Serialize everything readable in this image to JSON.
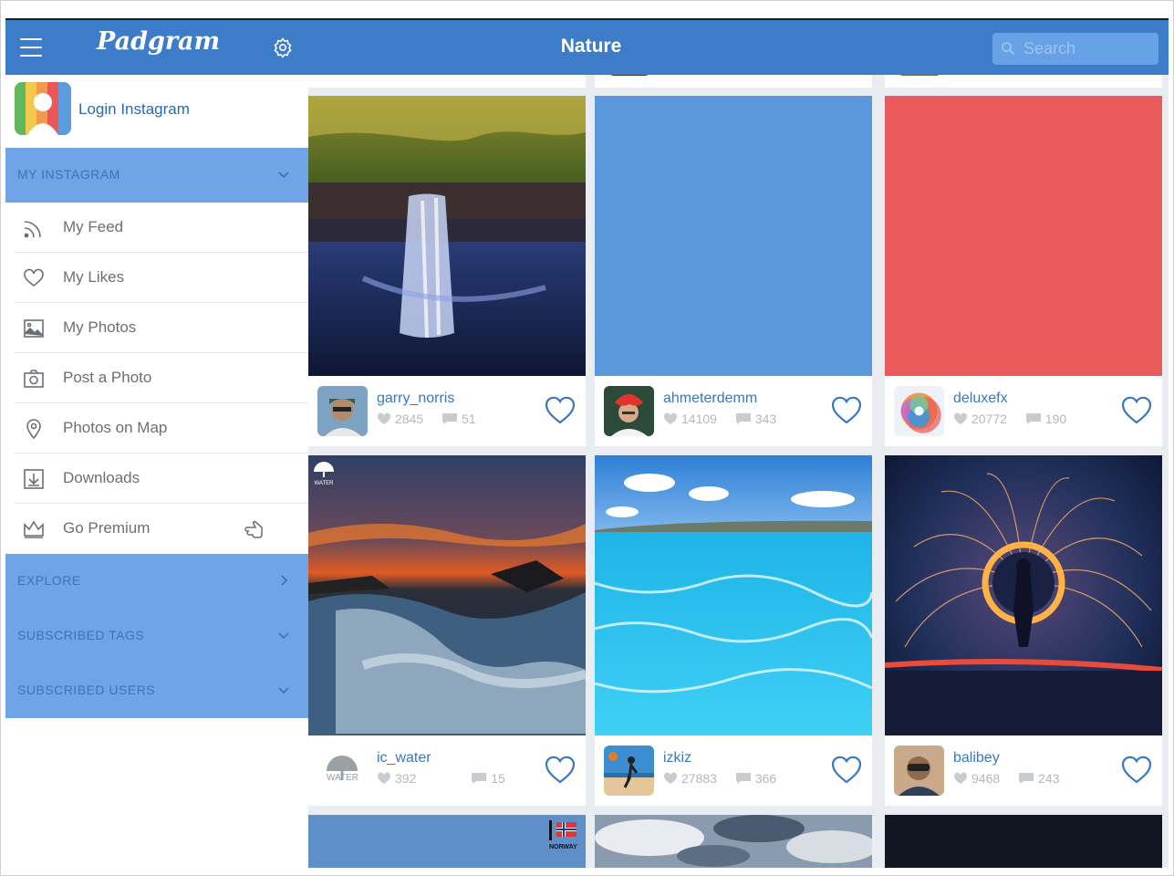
{
  "app": {
    "brand": "Padgram",
    "page_title": "Nature"
  },
  "search": {
    "placeholder": "Search"
  },
  "sidebar": {
    "login_label": "Login Instagram",
    "my_instagram": "MY INSTAGRAM",
    "items": [
      {
        "label": "My Feed",
        "icon": "feed-icon"
      },
      {
        "label": "My Likes",
        "icon": "heart-icon"
      },
      {
        "label": "My Photos",
        "icon": "photo-icon"
      },
      {
        "label": "Post a Photo",
        "icon": "camera-icon"
      },
      {
        "label": "Photos on Map",
        "icon": "map-pin-icon"
      },
      {
        "label": "Downloads",
        "icon": "download-icon"
      },
      {
        "label": "Go Premium",
        "icon": "crown-icon"
      }
    ],
    "sections": [
      "EXPLORE",
      "SUBSCRIBED TAGS",
      "SUBSCRIBED USERS"
    ]
  },
  "posts": [
    {
      "user": "garry_norris",
      "likes": "2845",
      "comments": "51"
    },
    {
      "user": "ahmeterdemm",
      "likes": "14109",
      "comments": "343"
    },
    {
      "user": "deluxefx",
      "likes": "20772",
      "comments": "190"
    },
    {
      "user": "ic_water",
      "likes": "392",
      "comments": "15"
    },
    {
      "user": "izkiz",
      "likes": "27883",
      "comments": "366"
    },
    {
      "user": "balibey",
      "likes": "9468",
      "comments": "243"
    }
  ],
  "watermarks": {
    "water": "WATER",
    "norway": "NORWAY"
  },
  "colors": {
    "header": "#3d7cc9",
    "section": "#6fa5e6",
    "accent": "#3a77c0",
    "placeholder_blue": "#5b97db",
    "placeholder_red": "#ea5b5b"
  }
}
